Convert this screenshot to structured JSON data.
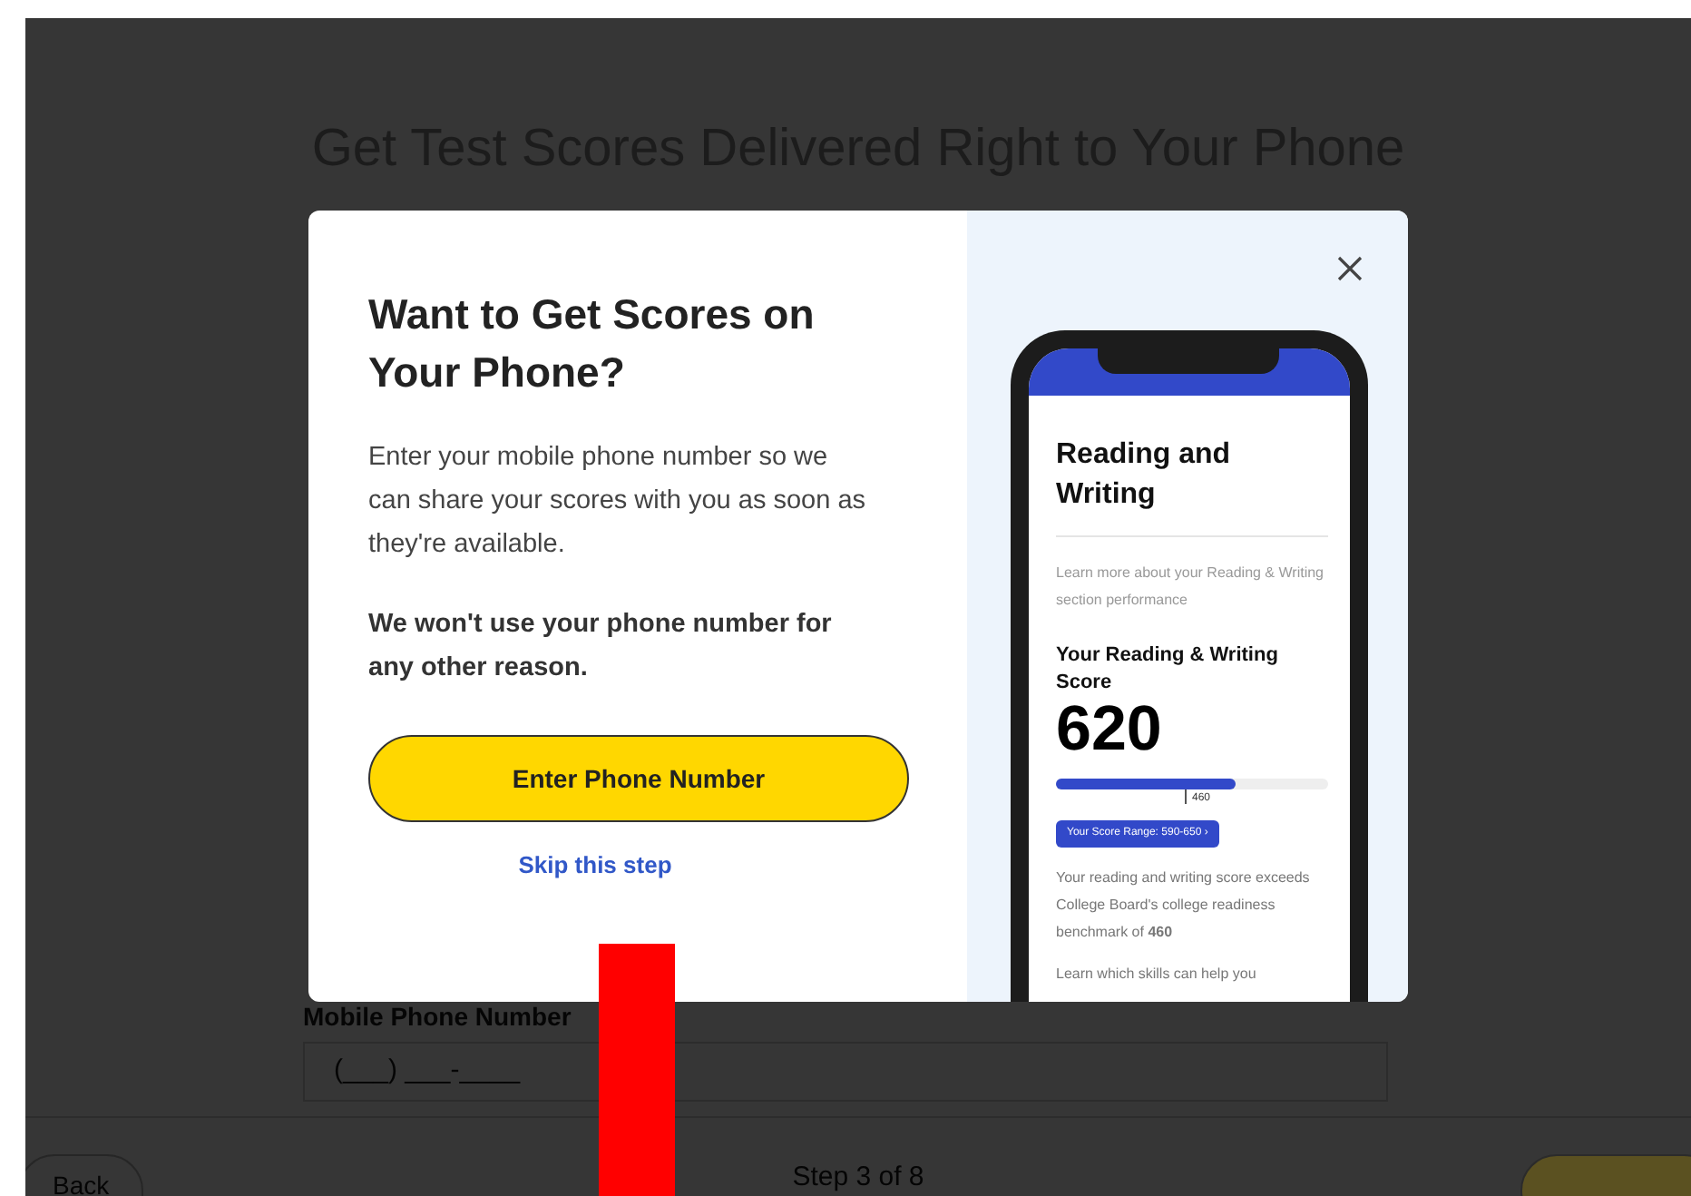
{
  "page": {
    "title": "Get Test Scores Delivered Right to Your Phone",
    "field": {
      "label": "Mobile Phone Number",
      "placeholder": "(___) ___-____"
    },
    "footer": {
      "back": "Back",
      "step": "Step 3 of 8"
    }
  },
  "modal": {
    "title": "Want to Get Scores on Your Phone?",
    "body": "Enter your mobile phone number so we can share your scores with you as soon as they're available.",
    "note": "We won't use your phone number for any other reason.",
    "primary_button": "Enter Phone Number",
    "skip_link": "Skip this step",
    "phone_preview": {
      "heading": "Reading and Writing",
      "intro": "Learn more about your Reading & Writing section performance",
      "score_label": "Your Reading & Writing Score",
      "score": "620",
      "score_bar": {
        "level": 0.66
      },
      "benchmark_label": "460",
      "range_button": "Your Score Range: 590-650 ›",
      "summary": "Your reading and writing score exceeds College Board's college readiness benchmark of **460**",
      "more": "Learn which skills can help you"
    }
  }
}
